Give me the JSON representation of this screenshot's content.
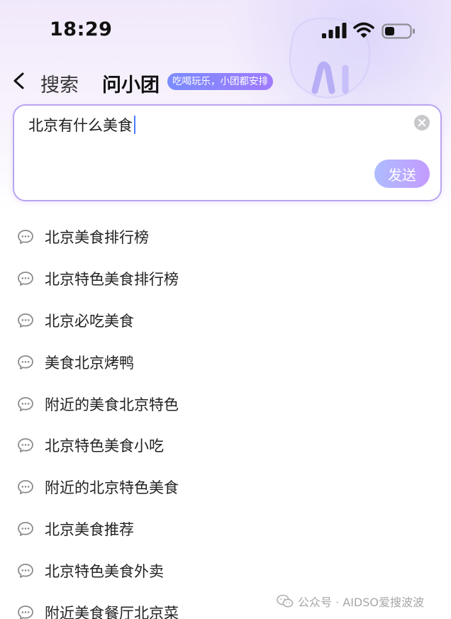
{
  "status_bar": {
    "time": "18:29"
  },
  "icons": {
    "moon": "moon-icon",
    "signal": "cellular-signal-icon",
    "wifi": "wifi-icon",
    "battery": "battery-icon",
    "back": "chevron-left-icon",
    "clear": "clear-x-icon",
    "suggestion": "chat-bubble-icon",
    "watermark": "wechat-icon"
  },
  "header": {
    "search_label": "搜索",
    "brand_label": "问小团",
    "badge_text": "吃喝玩乐，小团都安排"
  },
  "input": {
    "value": "北京有什么美食",
    "send_label": "发送"
  },
  "suggestions": [
    "北京美食排行榜",
    "北京特色美食排行榜",
    "北京必吃美食",
    "美食北京烤鸭",
    "附近的美食北京特色",
    "北京特色美食小吃",
    "附近的北京特色美食",
    "北京美食推荐",
    "北京特色美食外卖",
    "附近美食餐厅北京菜"
  ],
  "watermark": {
    "text": "公众号 · AIDSO爱搜波波"
  },
  "colors": {
    "accent_purple": "#b9a4f1",
    "badge_gradient_start": "#7b8cff",
    "badge_gradient_end": "#a07bff",
    "caret": "#4a7bff"
  }
}
